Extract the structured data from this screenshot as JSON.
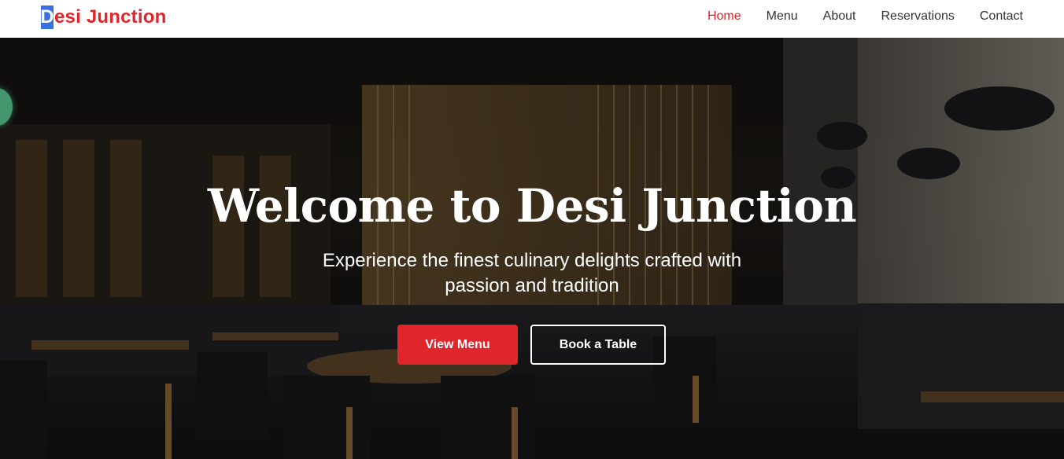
{
  "header": {
    "brand_first_letter": "D",
    "brand_rest": "esi Junction",
    "nav": [
      {
        "label": "Home",
        "active": true
      },
      {
        "label": "Menu",
        "active": false
      },
      {
        "label": "About",
        "active": false
      },
      {
        "label": "Reservations",
        "active": false
      },
      {
        "label": "Contact",
        "active": false
      }
    ]
  },
  "hero": {
    "title": "Welcome to Desi Junction",
    "subtitle": "Experience the finest culinary delights crafted with passion and tradition",
    "primary_button": "View Menu",
    "secondary_button": "Book a Table"
  },
  "colors": {
    "accent": "#e0252b",
    "brand_highlight": "#3a6fe0",
    "nav_text": "#333333",
    "header_bg": "#ffffff"
  }
}
